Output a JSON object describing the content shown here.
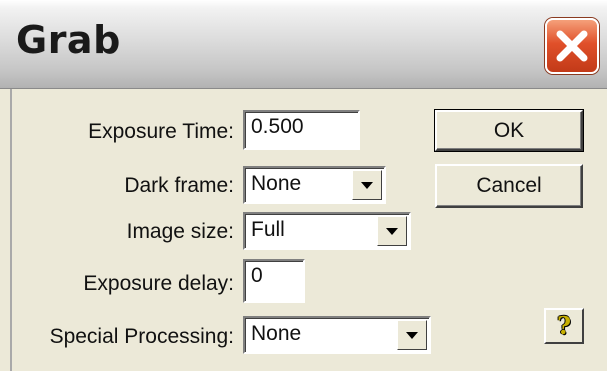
{
  "window": {
    "title": "Grab",
    "close_icon": "close-x-icon"
  },
  "form": {
    "exposure_time": {
      "label": "Exposure Time:",
      "value": "0.500"
    },
    "dark_frame": {
      "label": "Dark frame:",
      "value": "None"
    },
    "image_size": {
      "label": "Image size:",
      "value": "Full"
    },
    "exposure_delay": {
      "label": "Exposure delay:",
      "value": "0"
    },
    "special_processing": {
      "label": "Special Processing:",
      "value": "None"
    }
  },
  "buttons": {
    "ok": "OK",
    "cancel": "Cancel",
    "help_icon": "question-mark-icon"
  },
  "colors": {
    "dialog_background": "#ece9d8",
    "close_button": "#e0502a",
    "help_glyph": "#c8b000"
  }
}
